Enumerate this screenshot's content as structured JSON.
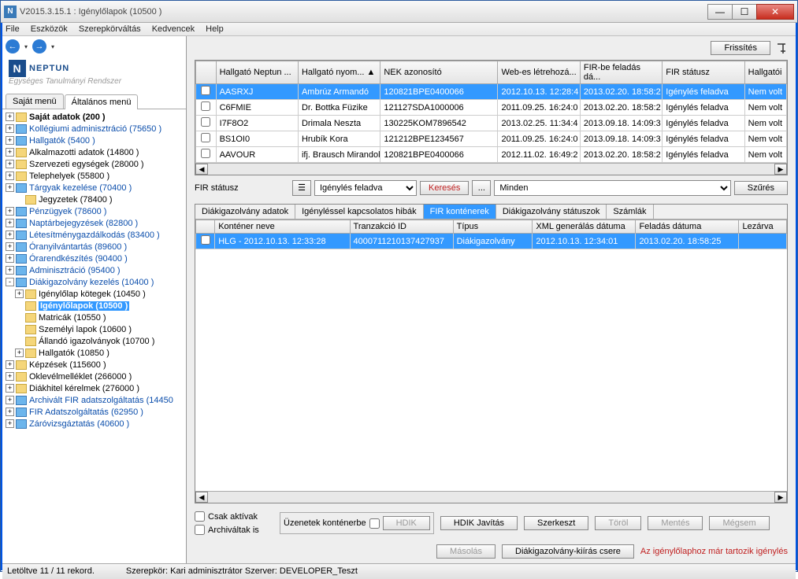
{
  "window": {
    "title": "V2015.3.15.1 : Igénylőlapok (10500  )"
  },
  "menu": {
    "file": "File",
    "eszk": "Eszközök",
    "szerep": "Szerepkörváltás",
    "kedv": "Kedvencek",
    "help": "Help"
  },
  "logo": {
    "main": "NEPTUN",
    "sub": "Egységes Tanulmányi Rendszer"
  },
  "left_tabs": {
    "sajat": "Saját menü",
    "alt": "Általános menü"
  },
  "tree": [
    {
      "t": "+",
      "label": "Saját adatok (200  )",
      "cls": "bold",
      "ind": 0,
      "ic": "y"
    },
    {
      "t": "+",
      "label": "Kollégiumi adminisztráció (75650  )",
      "cls": "link",
      "ind": 0,
      "ic": "b"
    },
    {
      "t": "+",
      "label": "Hallgatók (5400  )",
      "cls": "link",
      "ind": 0,
      "ic": "b"
    },
    {
      "t": "+",
      "label": "Alkalmazotti adatok (14800  )",
      "cls": "",
      "ind": 0,
      "ic": "y"
    },
    {
      "t": "+",
      "label": "Szervezeti egységek (28000  )",
      "cls": "",
      "ind": 0,
      "ic": "y"
    },
    {
      "t": "+",
      "label": "Telephelyek (55800  )",
      "cls": "",
      "ind": 0,
      "ic": "y"
    },
    {
      "t": "+",
      "label": "Tárgyak kezelése (70400  )",
      "cls": "link",
      "ind": 0,
      "ic": "b"
    },
    {
      "t": "",
      "label": "Jegyzetek (78400  )",
      "cls": "",
      "ind": 1,
      "ic": "y"
    },
    {
      "t": "+",
      "label": "Pénzügyek (78600  )",
      "cls": "link",
      "ind": 0,
      "ic": "b"
    },
    {
      "t": "+",
      "label": "Naptárbejegyzések (82800  )",
      "cls": "link",
      "ind": 0,
      "ic": "b"
    },
    {
      "t": "+",
      "label": "Létesítménygazdálkodás (83400  )",
      "cls": "link",
      "ind": 0,
      "ic": "b"
    },
    {
      "t": "+",
      "label": "Óranyilvántartás (89600  )",
      "cls": "link",
      "ind": 0,
      "ic": "b"
    },
    {
      "t": "+",
      "label": "Órarendkészítés (90400  )",
      "cls": "link",
      "ind": 0,
      "ic": "b"
    },
    {
      "t": "+",
      "label": "Adminisztráció (95400  )",
      "cls": "link",
      "ind": 0,
      "ic": "b"
    },
    {
      "t": "-",
      "label": "Diákigazolvány kezelés (10400  )",
      "cls": "link",
      "ind": 0,
      "ic": "b"
    },
    {
      "t": "+",
      "label": "Igénylőlap kötegek (10450  )",
      "cls": "",
      "ind": 1,
      "ic": "y"
    },
    {
      "t": "",
      "label": "Igénylőlapok (10500  )",
      "cls": "sel",
      "ind": 1,
      "ic": "y"
    },
    {
      "t": "",
      "label": "Matricák (10550  )",
      "cls": "",
      "ind": 1,
      "ic": "y"
    },
    {
      "t": "",
      "label": "Személyi lapok (10600  )",
      "cls": "",
      "ind": 1,
      "ic": "y"
    },
    {
      "t": "",
      "label": "Állandó igazolványok (10700  )",
      "cls": "",
      "ind": 1,
      "ic": "y"
    },
    {
      "t": "+",
      "label": "Hallgatók (10850  )",
      "cls": "",
      "ind": 1,
      "ic": "y"
    },
    {
      "t": "+",
      "label": "Képzések (115600  )",
      "cls": "",
      "ind": 0,
      "ic": "y"
    },
    {
      "t": "+",
      "label": "Oklevélmelléklet (266000  )",
      "cls": "",
      "ind": 0,
      "ic": "y"
    },
    {
      "t": "+",
      "label": "Diákhitel kérelmek (276000  )",
      "cls": "",
      "ind": 0,
      "ic": "y"
    },
    {
      "t": "+",
      "label": "Archivált FIR adatszolgáltatás (14450",
      "cls": "link",
      "ind": 0,
      "ic": "b"
    },
    {
      "t": "+",
      "label": "FIR Adatszolgáltatás (62950  )",
      "cls": "link",
      "ind": 0,
      "ic": "b"
    },
    {
      "t": "+",
      "label": "Záróvizsgáztatás (40600  )",
      "cls": "link",
      "ind": 0,
      "ic": "b"
    }
  ],
  "toolbar": {
    "refresh": "Frissítés"
  },
  "grid1": {
    "headers": [
      "",
      "Hallgató Neptun ...",
      "Hallgató nyom... ▲",
      "NEK azonosító",
      "Web-es létrehozá...",
      "FIR-be feladás dá...",
      "FIR státusz",
      "Hallgatói"
    ],
    "rows": [
      [
        "",
        "AASRXJ",
        "Ambrúz Armandó",
        "120821BPE0400066",
        "2012.10.13. 12:28:4",
        "2013.02.20. 18:58:2",
        "Igénylés feladva",
        "Nem volt"
      ],
      [
        "",
        "C6FMIE",
        "Dr. Bottka Füzike",
        "121127SDA1000006",
        "2011.09.25. 16:24:0",
        "2013.02.20. 18:58:2",
        "Igénylés feladva",
        "Nem volt"
      ],
      [
        "",
        "I7F8O2",
        "Drimala Neszta",
        "130225KOM7896542",
        "2013.02.25. 11:34:4",
        "2013.09.18. 14:09:3",
        "Igénylés feladva",
        "Nem volt"
      ],
      [
        "",
        "BS1OI0",
        "Hrubík Kora",
        "121212BPE1234567",
        "2011.09.25. 16:24:0",
        "2013.09.18. 14:09:3",
        "Igénylés feladva",
        "Nem volt"
      ],
      [
        "",
        "AAVOUR",
        "ifj. Brausch Mirandol",
        "120821BPE0400066",
        "2012.11.02. 16:49:2",
        "2013.02.20. 18:58:2",
        "Igénylés feladva",
        "Nem volt"
      ]
    ],
    "sel": 0
  },
  "filter": {
    "label": "FIR státusz",
    "value": "Igénylés feladva",
    "keres": "Keresés",
    "dots": "...",
    "minden": "Minden",
    "szures": "Szűrés"
  },
  "subtabs": [
    "Diákigazolvány adatok",
    "Igényléssel kapcsolatos hibák",
    "FIR konténerek",
    "Diákigazolvány státuszok",
    "Számlák"
  ],
  "subtab_active": 2,
  "grid2": {
    "headers": [
      "",
      "Konténer neve",
      "Tranzakció ID",
      "Típus",
      "XML generálás dátuma",
      "Feladás dátuma",
      "Lezárva"
    ],
    "rows": [
      [
        "",
        "HLG - 2012.10.13. 12:33:28",
        "4000711210137427937",
        "Diákigazolvány",
        "2012.10.13. 12:34:01",
        "2013.02.20. 18:58:25",
        ""
      ]
    ]
  },
  "bottom": {
    "csak": "Csak aktívak",
    "arch": "Archiváltak is",
    "uzenet": "Üzenetek konténerbe",
    "hdik": "HDIK",
    "hdik_javit": "HDIK Javítás",
    "szerk": "Szerkeszt",
    "torol": "Töröl",
    "mentes": "Mentés",
    "megsem": "Mégsem",
    "masolas": "Másolás",
    "diakig": "Diákigazolvány-kiírás csere",
    "warning": "Az igénylőlaphoz már tartozik igénylés"
  },
  "status": {
    "left": "Letöltve 11 / 11 rekord.",
    "mid": "Szerepkör: Kari adminisztrátor  Szerver: DEVELOPER_Teszt"
  }
}
